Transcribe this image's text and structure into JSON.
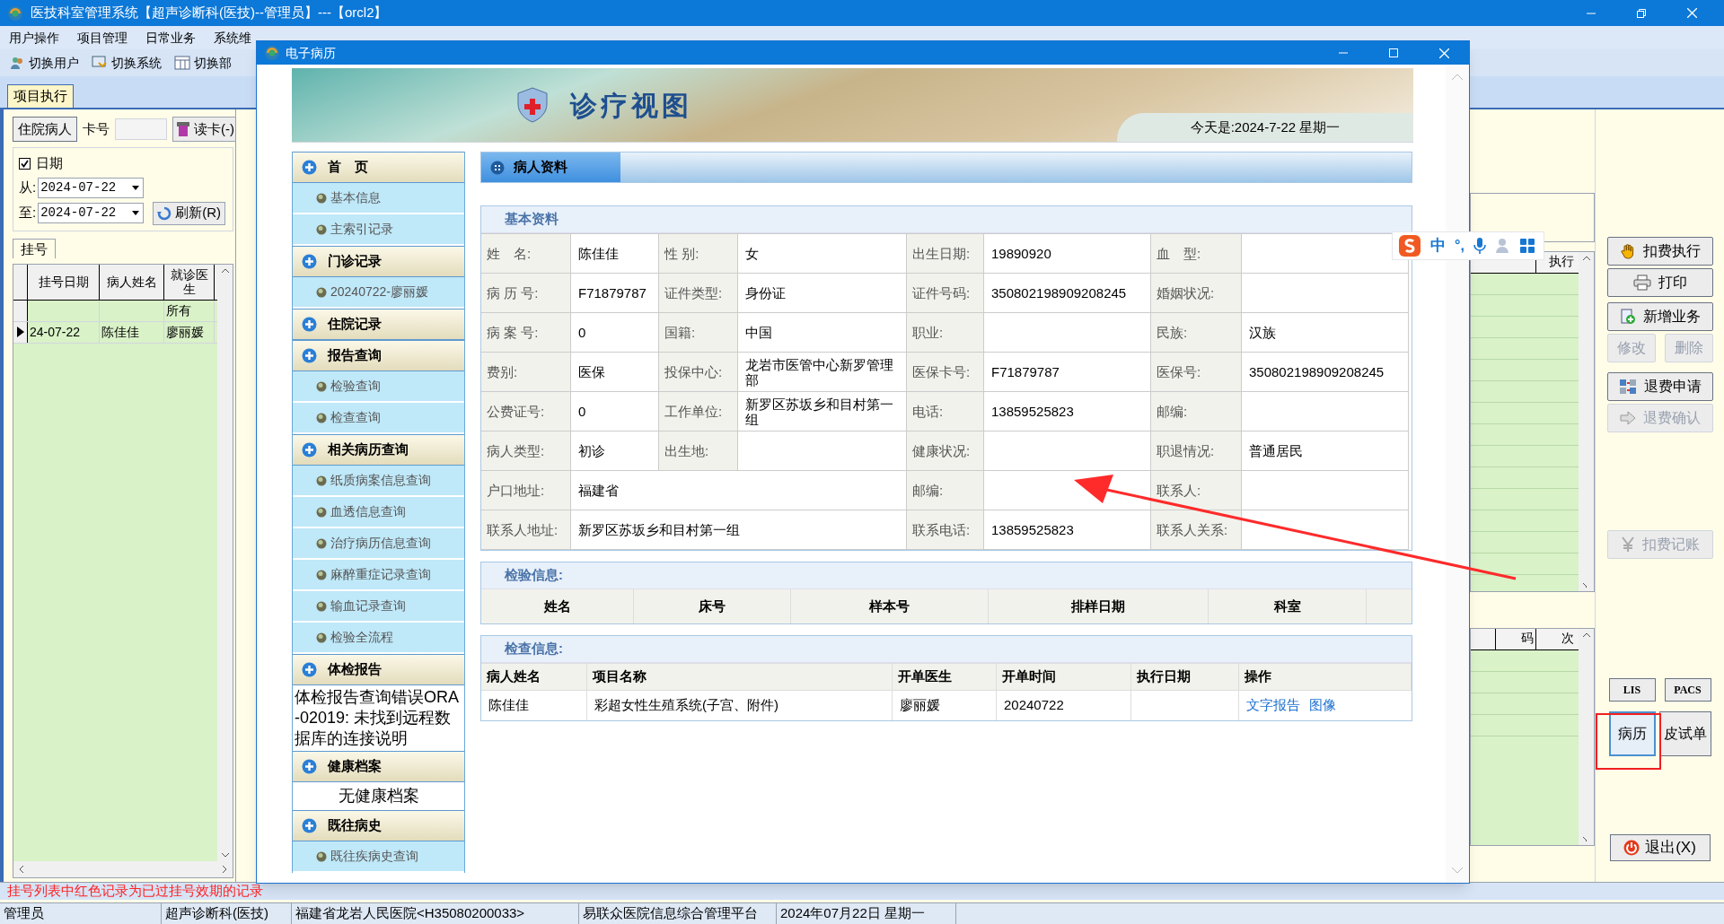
{
  "app": {
    "title": "医技科室管理系统【超声诊断科(医技)--管理员】---【orcl2】",
    "menu": [
      "用户操作",
      "项目管理",
      "日常业务",
      "系统维"
    ],
    "toolbar": [
      "切换用户",
      "切换系统",
      "切换部"
    ],
    "tabs": [
      {
        "label": "项目执行",
        "selected": true
      }
    ]
  },
  "left_panel": {
    "inpatient_button": "住院病人",
    "card_label": "卡号",
    "read_card_button": "读卡(-)",
    "date_filter": {
      "label": "日期",
      "checked": true
    },
    "from_label": "从:",
    "from_value": "2024-07-22",
    "to_label": "至:",
    "to_value": "2024-07-22",
    "refresh_button": "刷新(R)",
    "grid_tabs": [
      {
        "label": "挂号",
        "selected": true
      }
    ],
    "grid": {
      "columns": [
        "挂号日期",
        "病人姓名",
        "就诊医生"
      ],
      "rows": [
        {
          "doctor": "所有",
          "current": false
        },
        {
          "date": "24-07-22",
          "name": "陈佳佳",
          "doctor": "廖丽媛",
          "current": true
        }
      ]
    }
  },
  "modal": {
    "title": "电子病历",
    "banner_title": "诊疗视图",
    "today": "今天是:2024-7-22 星期一",
    "nav": [
      {
        "label": "首　页",
        "children": [
          {
            "label": "基本信息"
          },
          {
            "label": "主索引记录"
          }
        ]
      },
      {
        "label": "门诊记录",
        "children": [
          {
            "label": "20240722-廖丽媛"
          }
        ]
      },
      {
        "label": "住院记录"
      },
      {
        "label": "报告查询",
        "children": [
          {
            "label": "检验查询"
          },
          {
            "label": "检查查询"
          }
        ]
      },
      {
        "label": "相关病历查询",
        "children": [
          {
            "label": "纸质病案信息查询"
          },
          {
            "label": "血透信息查询"
          },
          {
            "label": "治疗病历信息查询"
          },
          {
            "label": "麻醉重症记录查询"
          },
          {
            "label": "输血记录查询"
          },
          {
            "label": "检验全流程"
          }
        ]
      },
      {
        "label": "体检报告",
        "note": "体检报告查询错误ORA-02019: 未找到远程数据库的连接说明"
      },
      {
        "label": "健康档案",
        "note": "无健康档案"
      },
      {
        "label": "既往病史",
        "children": [
          {
            "label": "既往疾病史查询"
          }
        ]
      }
    ],
    "tabs": [
      {
        "label": "病人资料",
        "selected": true
      }
    ],
    "basic": {
      "title": "基本资料",
      "rows": [
        [
          {
            "label": "姓　名:",
            "value": "陈佳佳"
          },
          {
            "label": "性 别:",
            "value": "女"
          },
          {
            "label": "出生日期:",
            "value": "19890920"
          },
          {
            "label": "血　型:"
          }
        ],
        [
          {
            "label": "病 历 号:",
            "value": "F71879787"
          },
          {
            "label": "证件类型:",
            "value": "身份证"
          },
          {
            "label": "证件号码:",
            "value": "350802198909208245"
          },
          {
            "label": "婚姻状况:"
          }
        ],
        [
          {
            "label": "病 案 号:",
            "value": "0"
          },
          {
            "label": "国籍:",
            "value": "中国"
          },
          {
            "label": "职业:"
          },
          {
            "label": "民族:",
            "value": "汉族"
          }
        ],
        [
          {
            "label": "费别:",
            "value": "医保"
          },
          {
            "label": "投保中心:",
            "value": "龙岩市医管中心新罗管理部"
          },
          {
            "label": "医保卡号:",
            "value": "F71879787"
          },
          {
            "label": "医保号:",
            "value": "350802198909208245"
          }
        ],
        [
          {
            "label": "公费证号:",
            "value": "0"
          },
          {
            "label": "工作单位:",
            "value": "新罗区苏坂乡和目村第一组"
          },
          {
            "label": "电话:",
            "value": "13859525823"
          },
          {
            "label": "邮编:"
          }
        ],
        [
          {
            "label": "病人类型:",
            "value": "初诊"
          },
          {
            "label": "出生地:"
          },
          {
            "label": "健康状况:"
          },
          {
            "label": "职退情况:",
            "value": "普通居民"
          }
        ],
        [
          {
            "label": "户口地址:",
            "value": "福建省",
            "wide": true
          },
          {
            "label": "邮编:"
          },
          {
            "label": "联系人:"
          }
        ],
        [
          {
            "label": "联系人地址:",
            "value": "新罗区苏坂乡和目村第一组",
            "wide": true
          },
          {
            "label": "联系电话:",
            "value": "13859525823"
          },
          {
            "label": "联系人关系:"
          }
        ]
      ]
    },
    "lab": {
      "title": "检验信息:",
      "columns": [
        "姓名",
        "床号",
        "样本号",
        "排样日期",
        "科室"
      ]
    },
    "exam": {
      "title": "检查信息:",
      "columns": [
        "病人姓名",
        "项目名称",
        "开单医生",
        "开单时间",
        "执行日期",
        "操作"
      ],
      "rows": [
        {
          "patient": "陈佳佳",
          "item": "彩超女性生殖系统(子宫、附件)",
          "doctor": "廖丽媛",
          "time": "20240722",
          "actions": [
            "文字报告",
            "图像"
          ]
        }
      ]
    }
  },
  "right_panel": {
    "upper_grid_columns": [
      "执行"
    ],
    "lower_grid_columns": [
      "码",
      "次"
    ],
    "buttons": [
      {
        "label": "扣费执行",
        "disabled": false
      },
      {
        "label": "打印",
        "disabled": false
      },
      {
        "label": "新增业务",
        "disabled": false
      }
    ],
    "edit_buttons": [
      {
        "label": "修改",
        "disabled": true
      },
      {
        "label": "删除",
        "disabled": true
      }
    ],
    "refund_buttons": [
      {
        "label": "退费申请",
        "disabled": false
      },
      {
        "label": "退费确认",
        "disabled": true
      }
    ],
    "account_button": {
      "label": "扣费记账",
      "disabled": true
    },
    "system_buttons": [
      "LIS",
      "PACS"
    ],
    "record_buttons": [
      {
        "label": "病历",
        "selected": true
      },
      {
        "label": "皮试单",
        "selected": false
      }
    ],
    "exit_button": "退出(X)"
  },
  "ime": {
    "mode": "中",
    "punctuation": "°,"
  },
  "status_message": "挂号列表中红色记录为已过挂号效期的记录",
  "status_bar": [
    "管理员",
    "超声诊断科(医技)",
    "福建省龙岩人民医院<H35080200033>",
    "易联众医院信息综合管理平台",
    "2024年07月22日 星期一"
  ]
}
